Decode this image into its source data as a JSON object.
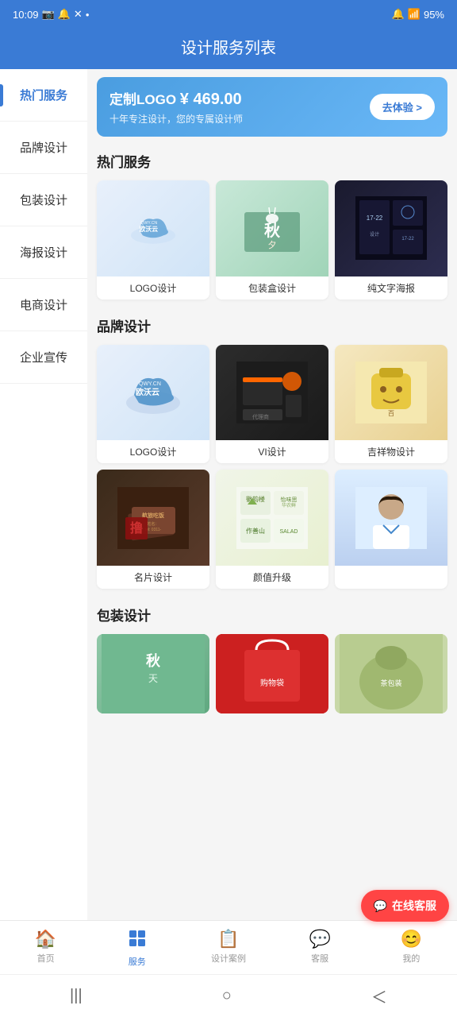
{
  "statusBar": {
    "time": "10:09",
    "batteryLevel": "95%"
  },
  "header": {
    "title": "设计服务列表"
  },
  "sidebar": {
    "items": [
      {
        "id": "hot",
        "label": "热门服务",
        "active": true
      },
      {
        "id": "brand",
        "label": "品牌设计",
        "active": false
      },
      {
        "id": "package",
        "label": "包装设计",
        "active": false
      },
      {
        "id": "poster",
        "label": "海报设计",
        "active": false
      },
      {
        "id": "ecom",
        "label": "电商设计",
        "active": false
      },
      {
        "id": "corp",
        "label": "企业宣传",
        "active": false
      }
    ]
  },
  "banner": {
    "title": "定制LOGO",
    "price": "¥ 469.00",
    "subtitle": "十年专注设计，您的专属设计师",
    "btnLabel": "去体验 >"
  },
  "sections": [
    {
      "id": "hot",
      "title": "热门服务",
      "items": [
        {
          "id": "logo",
          "label": "LOGO设计",
          "imgType": "logo"
        },
        {
          "id": "packbox",
          "label": "包装盒设计",
          "imgType": "package"
        },
        {
          "id": "poster",
          "label": "纯文字海报",
          "imgType": "poster"
        }
      ]
    },
    {
      "id": "brand",
      "title": "品牌设计",
      "items": [
        {
          "id": "logo2",
          "label": "LOGO设计",
          "imgType": "brand"
        },
        {
          "id": "vi",
          "label": "VI设计",
          "imgType": "vi"
        },
        {
          "id": "mascot",
          "label": "吉祥物设计",
          "imgType": "mascot"
        },
        {
          "id": "bizcard",
          "label": "名片设计",
          "imgType": "card"
        },
        {
          "id": "upgrade",
          "label": "颜值升级",
          "imgType": "upgrade"
        },
        {
          "id": "customer",
          "label": "",
          "imgType": "customer"
        }
      ]
    },
    {
      "id": "package",
      "title": "包装设计",
      "items": [
        {
          "id": "pack1",
          "label": "",
          "imgType": "pack1"
        },
        {
          "id": "pack2",
          "label": "",
          "imgType": "pack2"
        },
        {
          "id": "pack3",
          "label": "",
          "imgType": "pack3"
        }
      ]
    }
  ],
  "onlineService": {
    "label": "在线客服"
  },
  "bottomNav": {
    "items": [
      {
        "id": "home",
        "label": "首页",
        "icon": "🏠",
        "active": false
      },
      {
        "id": "service",
        "label": "服务",
        "icon": "⊞",
        "active": true
      },
      {
        "id": "cases",
        "label": "设计案例",
        "icon": "📋",
        "active": false
      },
      {
        "id": "support",
        "label": "客服",
        "icon": "💬",
        "active": false
      },
      {
        "id": "mine",
        "label": "我的",
        "icon": "😊",
        "active": false
      }
    ]
  },
  "phoneNav": {
    "items": [
      {
        "id": "menu",
        "icon": "|||"
      },
      {
        "id": "home",
        "icon": "○"
      },
      {
        "id": "back",
        "icon": "<"
      }
    ]
  }
}
